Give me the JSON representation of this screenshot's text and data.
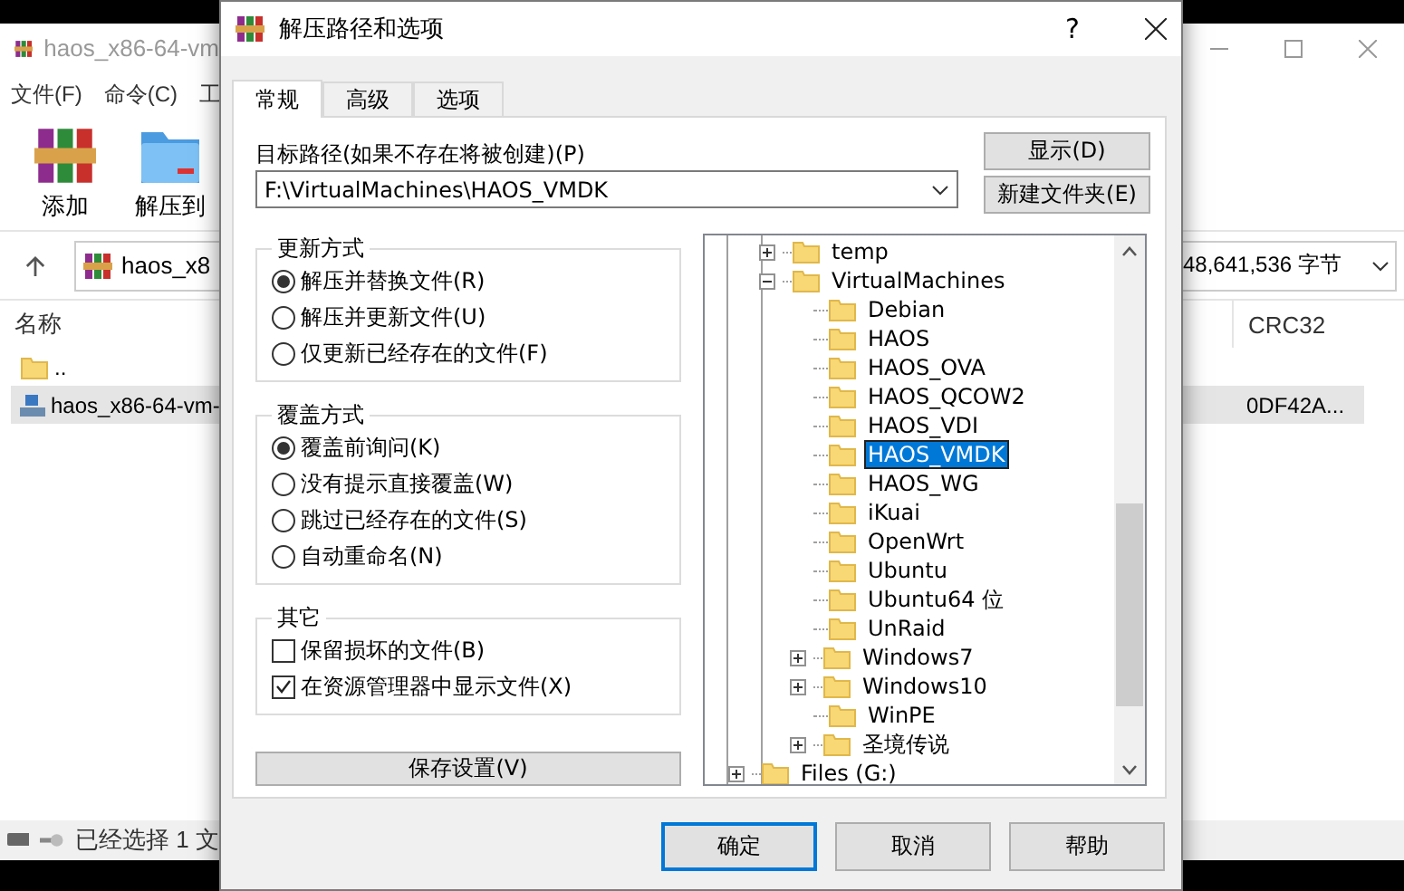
{
  "background_window": {
    "title": "haos_x86-64-vm",
    "menu": [
      "文件(F)",
      "命令(C)",
      "工"
    ],
    "toolbar": [
      {
        "label": "添加",
        "kind": "add"
      },
      {
        "label": "解压到",
        "kind": "extract"
      }
    ],
    "address": "haos_x8",
    "size_readout": "48,641,536 字节",
    "columns": [
      "名称",
      "CRC32"
    ],
    "rows": [
      {
        "name": "..",
        "kind": "parent",
        "selected": false
      },
      {
        "name": "haos_x86-64-vm-",
        "kind": "file",
        "crc": "0DF42A...",
        "selected": true
      }
    ],
    "status": "已经选择 1 文"
  },
  "dialog": {
    "title": "解压路径和选项",
    "help": "?",
    "tabs": [
      {
        "label": "常规",
        "selected": true
      },
      {
        "label": "高级",
        "selected": false
      },
      {
        "label": "选项",
        "selected": false
      }
    ],
    "path_label": "目标路径(如果不存在将被创建)(P)",
    "path_value": "F:\\VirtualMachines\\HAOS_VMDK",
    "side_buttons": [
      "显示(D)",
      "新建文件夹(E)"
    ],
    "update_mode": {
      "title": "更新方式",
      "options": [
        {
          "label": "解压并替换文件(R)",
          "selected": true
        },
        {
          "label": "解压并更新文件(U)",
          "selected": false
        },
        {
          "label": "仅更新已经存在的文件(F)",
          "selected": false
        }
      ]
    },
    "overwrite_mode": {
      "title": "覆盖方式",
      "options": [
        {
          "label": "覆盖前询问(K)",
          "selected": true
        },
        {
          "label": "没有提示直接覆盖(W)",
          "selected": false
        },
        {
          "label": "跳过已经存在的文件(S)",
          "selected": false
        },
        {
          "label": "自动重命名(N)",
          "selected": false
        }
      ]
    },
    "other": {
      "title": "其它",
      "options": [
        {
          "label": "保留损坏的文件(B)",
          "checked": false
        },
        {
          "label": "在资源管理器中显示文件(X)",
          "checked": true
        }
      ]
    },
    "save_button": "保存设置(V)",
    "tree": {
      "items": [
        {
          "label": "temp",
          "kind": "branch",
          "expanded": false,
          "selected": false
        },
        {
          "label": "VirtualMachines",
          "kind": "branch",
          "expanded": true,
          "selected": false,
          "children": [
            {
              "label": "Debian",
              "kind": "leaf",
              "selected": false
            },
            {
              "label": "HAOS",
              "kind": "leaf",
              "selected": false
            },
            {
              "label": "HAOS_OVA",
              "kind": "leaf",
              "selected": false
            },
            {
              "label": "HAOS_QCOW2",
              "kind": "leaf",
              "selected": false
            },
            {
              "label": "HAOS_VDI",
              "kind": "leaf",
              "selected": false
            },
            {
              "label": "HAOS_VMDK",
              "kind": "leaf",
              "selected": true
            },
            {
              "label": "HAOS_WG",
              "kind": "leaf",
              "selected": false
            },
            {
              "label": "iKuai",
              "kind": "leaf",
              "selected": false
            },
            {
              "label": "OpenWrt",
              "kind": "leaf",
              "selected": false
            },
            {
              "label": "Ubuntu",
              "kind": "leaf",
              "selected": false
            },
            {
              "label": "Ubuntu64 位",
              "kind": "leaf",
              "selected": false
            },
            {
              "label": "UnRaid",
              "kind": "leaf",
              "selected": false
            },
            {
              "label": "Windows7",
              "kind": "branch",
              "expanded": false,
              "selected": false
            },
            {
              "label": "Windows10",
              "kind": "branch",
              "expanded": false,
              "selected": false
            },
            {
              "label": "WinPE",
              "kind": "leaf",
              "selected": false
            },
            {
              "label": "圣境传说",
              "kind": "branch",
              "expanded": false,
              "selected": false
            }
          ]
        }
      ],
      "drives": [
        {
          "label": "Files (G:)",
          "kind": "branch",
          "expanded": false,
          "selected": false
        }
      ]
    },
    "footer_buttons": [
      {
        "label": "确定",
        "focused": true
      },
      {
        "label": "取消",
        "focused": false
      },
      {
        "label": "帮助",
        "focused": false
      }
    ]
  }
}
